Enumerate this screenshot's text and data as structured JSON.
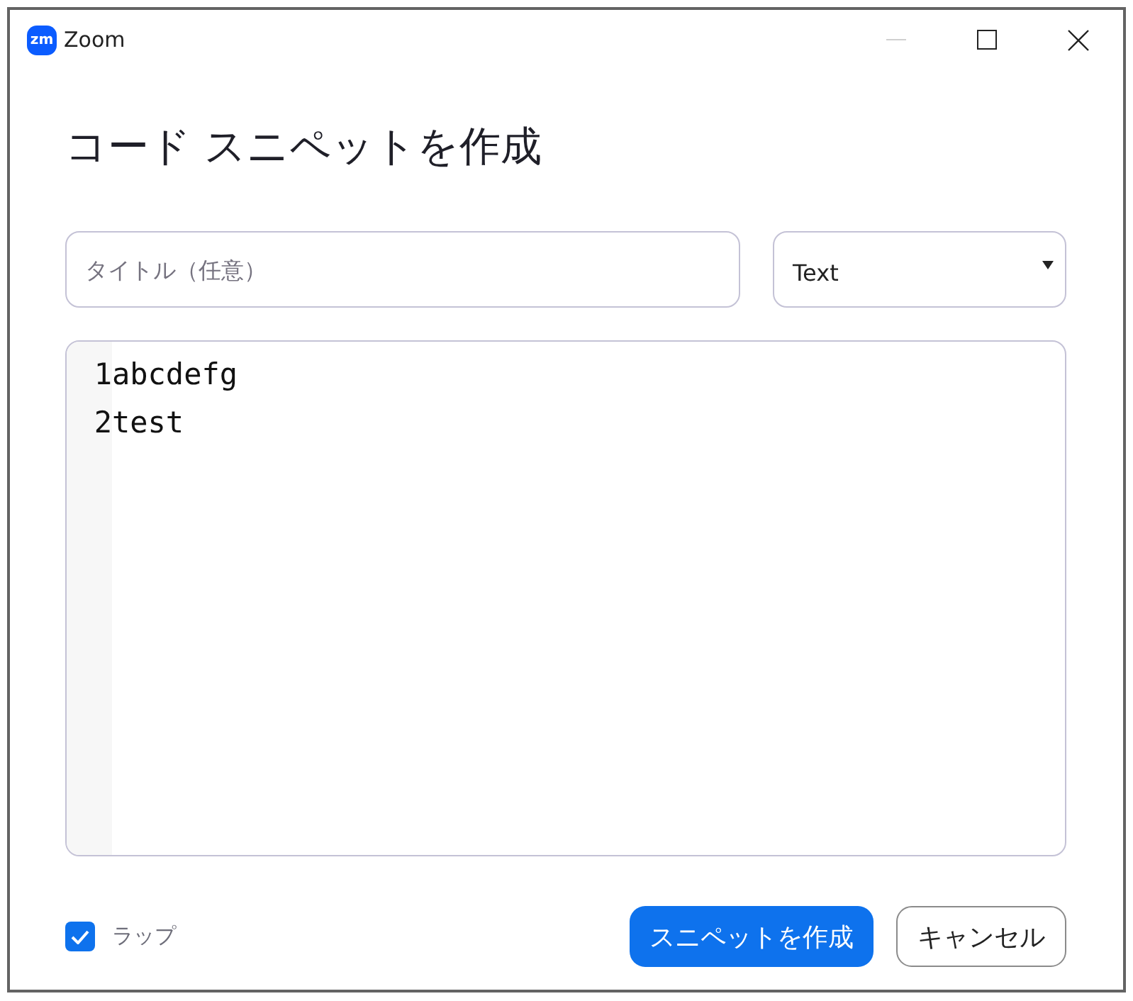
{
  "window": {
    "logo_text": "zm",
    "title": "Zoom",
    "minimize_disabled": true
  },
  "heading": "コード スニペットを作成",
  "title_field": {
    "placeholder": "タイトル（任意）"
  },
  "language_select": {
    "value": "Text"
  },
  "editor": {
    "lines": [
      {
        "number": "1",
        "text": "abcdefg"
      },
      {
        "number": "2",
        "text": "test"
      }
    ]
  },
  "wrap": {
    "label": "ラップ",
    "checked": true
  },
  "buttons": [
    {
      "label": "スニペットを作成",
      "kind": "primary"
    },
    {
      "label": "キャンセル",
      "kind": "secondary"
    }
  ]
}
